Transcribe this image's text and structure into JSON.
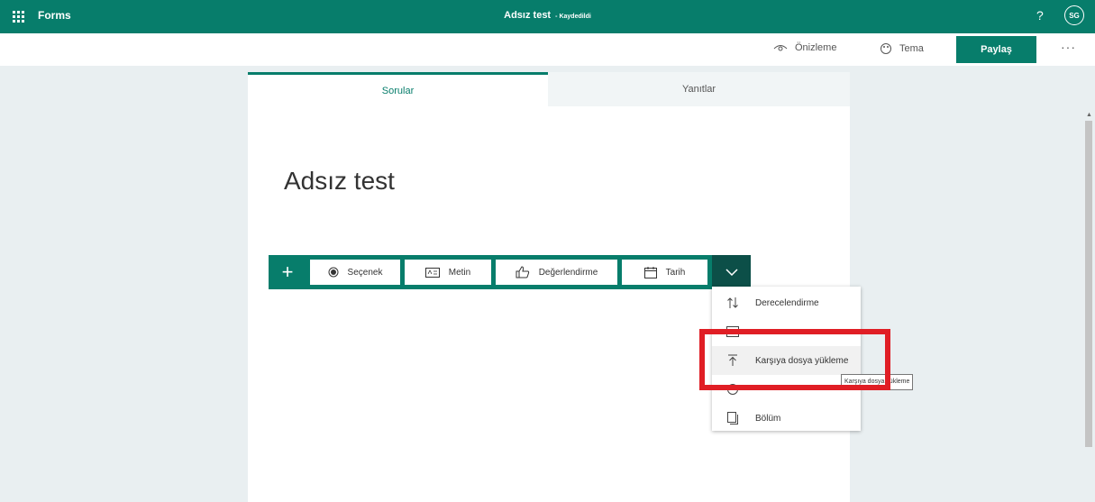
{
  "topbar": {
    "app_name": "Forms",
    "doc_title": "Adsız test",
    "save_status": "- Kaydedildi",
    "help": "?",
    "avatar": "SG"
  },
  "commands": {
    "preview": "Önizleme",
    "theme": "Tema",
    "share": "Paylaş",
    "more": "···"
  },
  "tabs": {
    "questions": "Sorular",
    "responses": "Yanıtlar"
  },
  "form": {
    "title": "Adsız test"
  },
  "question_types": {
    "add": "+",
    "choice": "Seçenek",
    "text": "Metin",
    "rating": "Değerlendirme",
    "date": "Tarih"
  },
  "dropdown": {
    "items": [
      {
        "label": "Derecelendirme",
        "icon": "sort-icon"
      },
      {
        "label": "",
        "icon": "grid-icon"
      },
      {
        "label": "Karşıya dosya yükleme",
        "icon": "upload-icon"
      },
      {
        "label": "",
        "icon": "nps-icon"
      },
      {
        "label": "Bölüm",
        "icon": "section-icon"
      }
    ]
  },
  "tooltip": "Karşıya dosya yükleme",
  "colors": {
    "brand": "#077d6b",
    "brand_dark": "#0c4f48",
    "annotation": "#e01e25",
    "background": "#e9eff1"
  }
}
